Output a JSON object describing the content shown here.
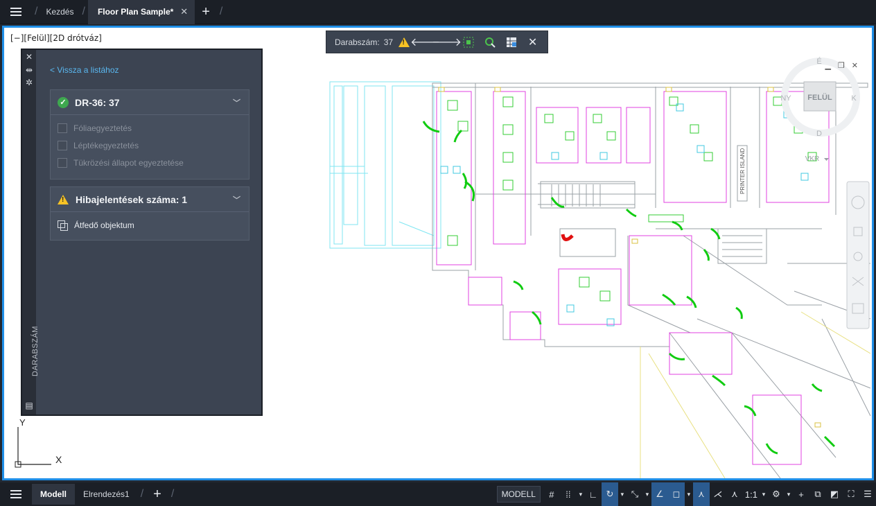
{
  "tabs": {
    "menu_icon": "hamburger-menu-icon",
    "items": [
      {
        "label": "Kezdés"
      },
      {
        "label": "Floor Plan Sample*",
        "close": "✕"
      }
    ],
    "add_label": "+"
  },
  "viewport": {
    "label": "[−][Felül][2D drótváz]",
    "window_controls": [
      "▁",
      "❐",
      "✕"
    ]
  },
  "count_toolbar": {
    "label": "Darabszám:",
    "value": "37",
    "buttons": [
      "warning-icon",
      "arrow-left-icon",
      "arrow-right-icon",
      "zoom-selection-icon",
      "find-icon",
      "insert-table-icon",
      "close-icon"
    ]
  },
  "palette": {
    "back_link": "< Vissza a listához",
    "vertical_label": "DARABSZÁM",
    "block_card": {
      "title": "DR-36: 37",
      "checks": [
        "Fóliaegyeztetés",
        "Léptékegyeztetés",
        "Tükrözési állapot egyeztetése"
      ]
    },
    "error_card": {
      "title": "Hibajelentések száma: 1",
      "item": "Átfedő objektum"
    }
  },
  "viewcube": {
    "top_label": "FELÜL",
    "n": "É",
    "w": "NY",
    "e": "K",
    "s": "D",
    "wcs": "VKR"
  },
  "plan": {
    "printer_island": "PRINTER ISLAND"
  },
  "ucs": {
    "y": "Y",
    "x": "X"
  },
  "statusbar": {
    "layout_tabs": [
      {
        "label": "Modell",
        "active": true
      },
      {
        "label": "Elrendezés1",
        "active": false
      }
    ],
    "model_button": "MODELL",
    "scale": "1:1"
  },
  "colors": {
    "accent": "#1f8fe8",
    "door_green": "#11cc11",
    "error_red": "#e01010"
  }
}
